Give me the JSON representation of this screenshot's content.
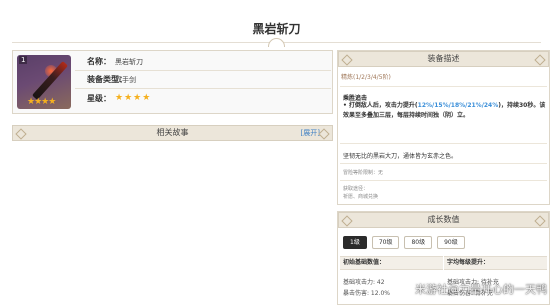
{
  "page": {
    "title": "黑岩斩刀"
  },
  "weapon": {
    "level_badge": "1",
    "image_stars": "★★★★",
    "rows": [
      {
        "key": "名称：",
        "value": "黑岩斩刀"
      },
      {
        "key": "装备类型：",
        "value": "双手剑"
      },
      {
        "key": "星级：",
        "value": "★★★★"
      }
    ]
  },
  "story": {
    "title": "相关故事",
    "expand_label": "[展开]"
  },
  "description": {
    "title": "装备描述",
    "refine": "精炼(1/2/3/4/5阶)",
    "effect_name": "乘胜追击",
    "effect_prefix": "• 打倒敌人后，攻击力提升(",
    "effect_values": "12%/15%/18%/21%/24%",
    "effect_suffix": ")，持续30秒。该效果至多叠加三层，每层持续时间独（阴）立。",
    "flavor": "坚韧无比的黑岩大刀，通体皆为玄赤之色。",
    "ascension": "冒险等阶限制：无",
    "obtain_label": "获取途径：",
    "obtain_value": "祈愿、商城兑换"
  },
  "growth": {
    "title": "成长数值",
    "tabs": [
      "1级",
      "70级",
      "80级",
      "90级"
    ],
    "active_tab": "1级",
    "base_header": "初始基础数值：",
    "ascend_header": "字均每级提升：",
    "base_atk": "基础攻击力: 42",
    "crit_dmg": "暴击伤害: 12.0%",
    "ascend_atk": "基础攻击力: 待补充",
    "ascend_crit": "暴击伤害: 待补充"
  },
  "watermark": "米游社@力量开心的一天鸭",
  "colors": {
    "accent_blue": "#3b8fd9",
    "star_gold": "#f5b01e",
    "header_bg": "#ece6da"
  }
}
